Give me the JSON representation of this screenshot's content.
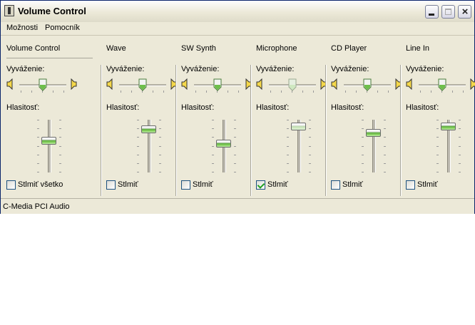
{
  "window": {
    "title": "Volume Control",
    "icon": "volume-app-icon",
    "controls": [
      "minimize-icon",
      "maximize-icon",
      "close-icon"
    ]
  },
  "menu": {
    "items": [
      "Možnosti",
      "Pomocník"
    ]
  },
  "channels": [
    {
      "title": "Volume Control",
      "balance_label": "Vyváženie:",
      "balance": 0.5,
      "volume_label": "Hlasitosť:",
      "volume": 0.62,
      "mute_label": "Stlmiť všetko",
      "muted": false,
      "dim": false
    },
    {
      "title": "Wave",
      "balance_label": "Vyváženie:",
      "balance": 0.5,
      "volume_label": "Hlasitosť:",
      "volume": 0.88,
      "mute_label": "Stlmiť",
      "muted": false,
      "dim": false
    },
    {
      "title": "SW Synth",
      "balance_label": "Vyváženie:",
      "balance": 0.5,
      "volume_label": "Hlasitosť:",
      "volume": 0.55,
      "mute_label": "Stlmiť",
      "muted": false,
      "dim": false
    },
    {
      "title": "Microphone",
      "balance_label": "Vyváženie:",
      "balance": 0.5,
      "volume_label": "Hlasitosť:",
      "volume": 0.93,
      "mute_label": "Stlmiť",
      "muted": true,
      "dim": true
    },
    {
      "title": "CD Player",
      "balance_label": "Vyváženie:",
      "balance": 0.5,
      "volume_label": "Hlasitosť:",
      "volume": 0.8,
      "mute_label": "Stlmiť",
      "muted": false,
      "dim": false
    },
    {
      "title": "Line In",
      "balance_label": "Vyváženie:",
      "balance": 0.5,
      "volume_label": "Hlasitosť:",
      "volume": 0.93,
      "mute_label": "Stlmiť",
      "muted": false,
      "dim": false
    }
  ],
  "status": {
    "text": "C-Media PCI Audio"
  }
}
